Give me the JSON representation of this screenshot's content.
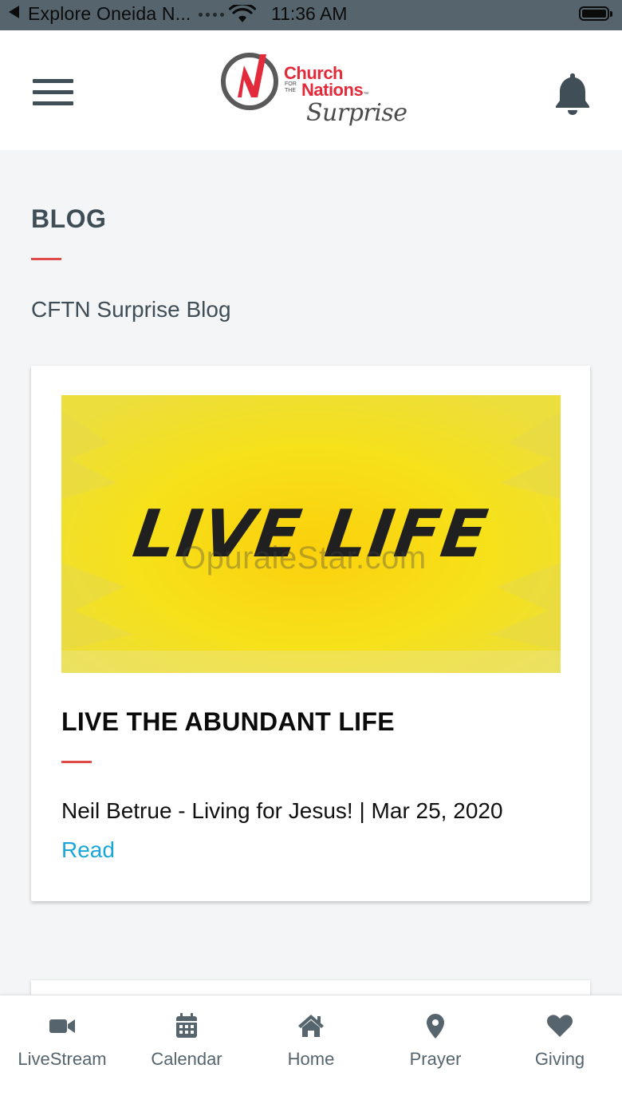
{
  "status_bar": {
    "app_name": "Explore Oneida N...",
    "time": "11:36 AM"
  },
  "header": {
    "logo": {
      "church": "Church",
      "for_the": "FOR THE",
      "nations": "Nations",
      "trademark": "™",
      "location": "Surprise"
    }
  },
  "page": {
    "title": "BLOG",
    "subtitle": "CFTN Surprise Blog"
  },
  "blog_posts": [
    {
      "image_text": "LIVE LIFE",
      "image_watermark": "OpuraieStar.com",
      "title": "LIVE THE ABUNDANT LIFE",
      "meta": "Neil Betrue - Living for Jesus! | Mar 25, 2020",
      "read_label": "Read"
    }
  ],
  "tabs": [
    {
      "label": "LiveStream",
      "icon": "video-camera-icon"
    },
    {
      "label": "Calendar",
      "icon": "calendar-icon"
    },
    {
      "label": "Home",
      "icon": "home-icon"
    },
    {
      "label": "Prayer",
      "icon": "map-pin-icon"
    },
    {
      "label": "Giving",
      "icon": "heart-icon"
    }
  ],
  "colors": {
    "status_bar": "#56656d",
    "accent_red": "#e04a4a",
    "link_blue": "#1aa6d9",
    "brand_red": "#e32a3a",
    "icon_gray": "#56656d",
    "image_yellow": "#f4e31a"
  }
}
